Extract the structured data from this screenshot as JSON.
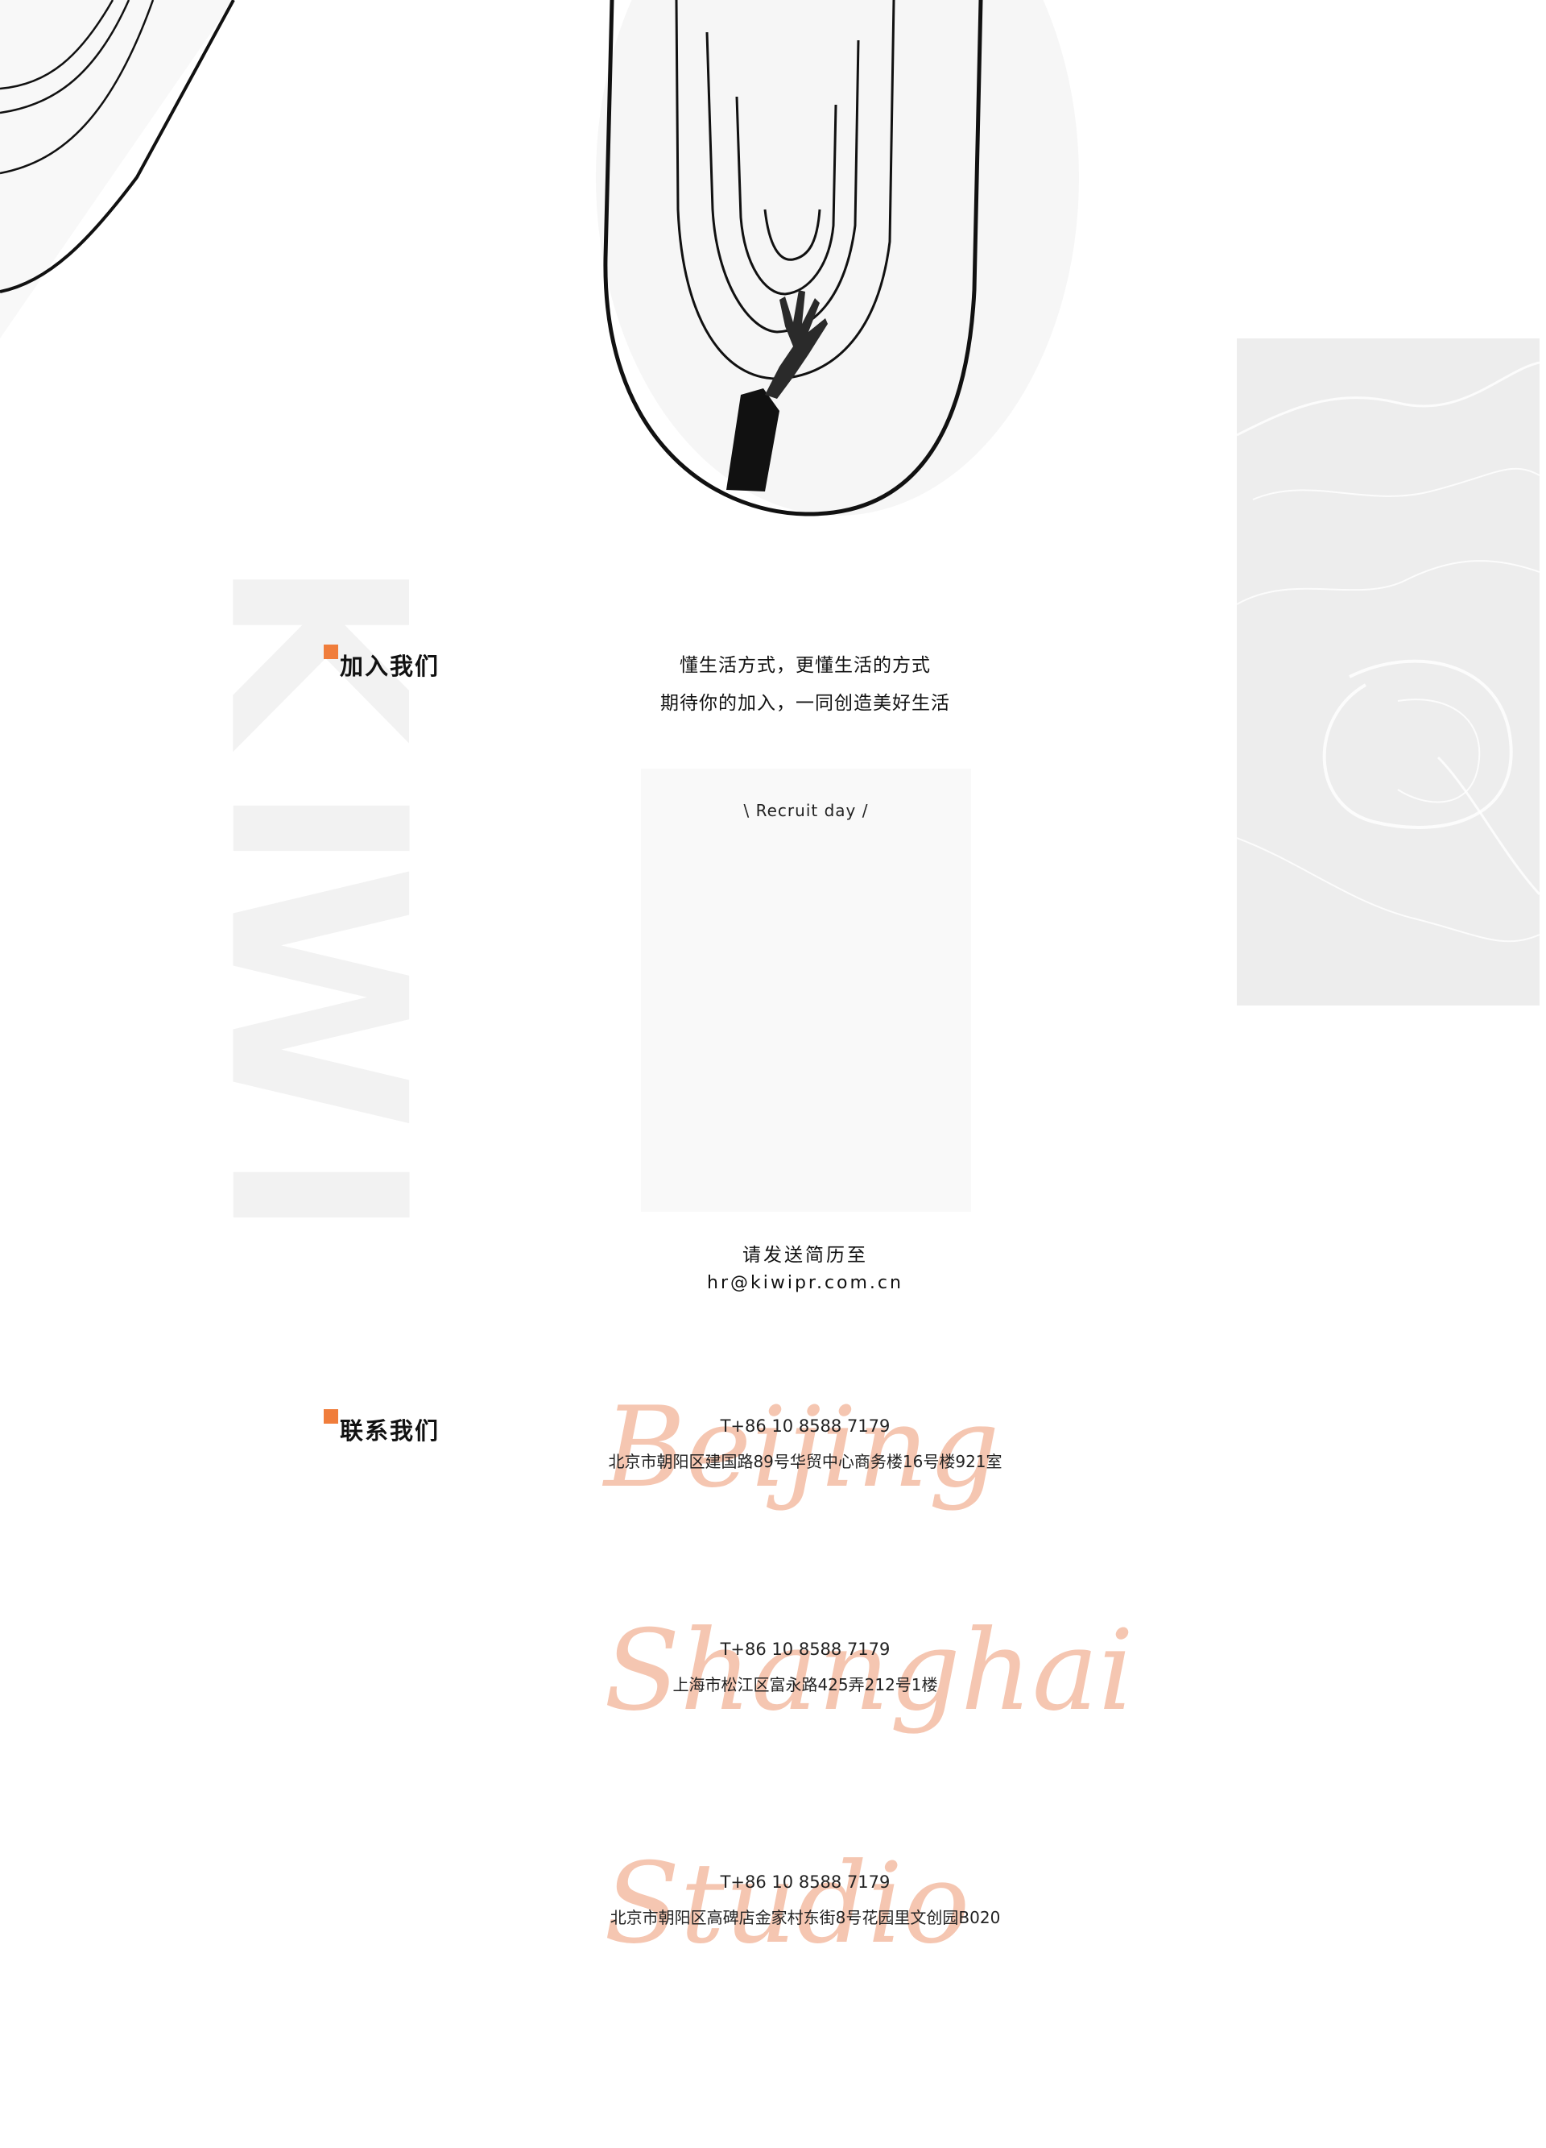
{
  "colors": {
    "accent_marker": "#f07d3b",
    "script_peach": "#f5c6b1",
    "watermark_gray": "#f2f2f2",
    "recruit_card_bg": "#f9f9f9",
    "marble_panel": "#ededed",
    "line_art": "#111111"
  },
  "hero": {
    "icon": "line-art-waving-hand-illustration"
  },
  "watermark": {
    "letters": [
      "K",
      "I",
      "W",
      "I"
    ]
  },
  "join": {
    "title": "加入我们",
    "intro_lines": [
      "懂生活方式，更懂生活的方式",
      "期待你的加入，一同创造美好生活"
    ],
    "recruit_card_title": "\\ Recruit day /",
    "resume_prompt": "请发送简历至",
    "resume_email": "hr@kiwipr.com.cn"
  },
  "contact": {
    "title": "联系我们",
    "offices": [
      {
        "script_label": "Beijing",
        "phone": "T+86 10 8588 7179",
        "address": "北京市朝阳区建国路89号华贸中心商务楼16号楼921室"
      },
      {
        "script_label": "Shanghai",
        "phone": "T+86 10 8588 7179",
        "address": "上海市松江区富永路425弄212号1楼"
      },
      {
        "script_label": "Studio",
        "phone": "T+86 10 8588 7179",
        "address": "北京市朝阳区高碑店金家村东街8号花园里文创园B020"
      }
    ]
  }
}
